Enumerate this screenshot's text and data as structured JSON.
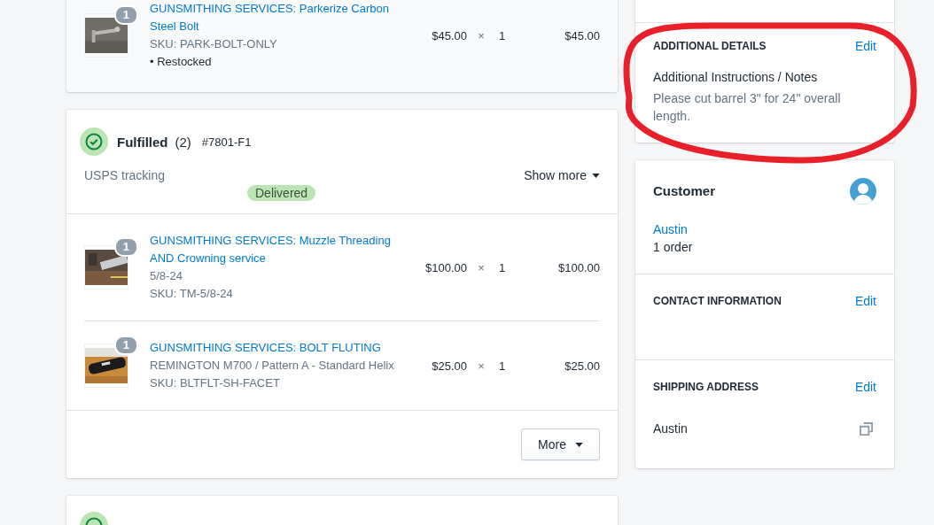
{
  "top_card": {
    "items": [
      {
        "title": "GUNSMITHING SERVICES: Parkerize Carbon Steel Bolt",
        "sku": "SKU: PARK-BOLT-ONLY",
        "note": "• Restocked",
        "quantity_badge": "1",
        "price": "$45.00",
        "times": "×",
        "qty": "1",
        "total": "$45.00"
      }
    ]
  },
  "fulfillment": {
    "title": "Fulfilled",
    "count": "(2)",
    "number": "#7801-F1",
    "tracking_label": "USPS tracking",
    "show_more": "Show more",
    "badge": "Delivered",
    "items": [
      {
        "title": "GUNSMITHING SERVICES: Muzzle Threading AND Crowning service",
        "variant": "5/8-24",
        "sku": "SKU: TM-5/8-24",
        "quantity_badge": "1",
        "price": "$100.00",
        "times": "×",
        "qty": "1",
        "total": "$100.00"
      },
      {
        "title": "GUNSMITHING SERVICES: BOLT FLUTING",
        "variant": "REMINGTON M700 / Pattern A - Standard Helix",
        "sku": "SKU: BLTFLT-SH-FACET",
        "quantity_badge": "1",
        "price": "$25.00",
        "times": "×",
        "qty": "1",
        "total": "$25.00"
      }
    ],
    "more_button": "More"
  },
  "additional_details": {
    "heading": "ADDITIONAL DETAILS",
    "edit": "Edit",
    "label": "Additional Instructions / Notes",
    "text": "Please cut barrel 3\" for 24\" overall length."
  },
  "customer": {
    "heading": "Customer",
    "name": "Austin",
    "orders": "1 order"
  },
  "contact": {
    "heading": "CONTACT INFORMATION",
    "edit": "Edit"
  },
  "shipping": {
    "heading": "SHIPPING ADDRESS",
    "edit": "Edit",
    "name": "Austin"
  }
}
